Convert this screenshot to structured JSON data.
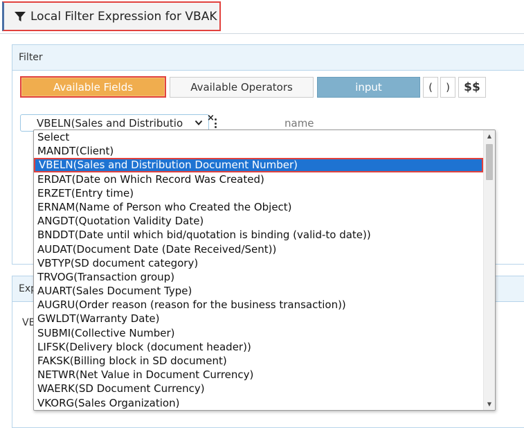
{
  "header": {
    "title": "Local Filter Expression for VBAK",
    "icon": "filter-icon"
  },
  "filter": {
    "section_label": "Filter",
    "buttons": {
      "available_fields": "Available Fields",
      "available_operators": "Available Operators",
      "input": "input",
      "open_paren": "(",
      "close_paren": ")",
      "dollars": "$$"
    },
    "field_select": {
      "value": "VBELN(Sales and Distributio"
    },
    "remove_symbol": "×",
    "name_placeholder": "name"
  },
  "expression": {
    "section_label": "Exp",
    "content": "VB"
  },
  "dropdown": {
    "options": [
      "Select",
      "MANDT(Client)",
      "VBELN(Sales and Distribution Document Number)",
      "ERDAT(Date on Which Record Was Created)",
      "ERZET(Entry time)",
      "ERNAM(Name of Person who Created the Object)",
      "ANGDT(Quotation Validity Date)",
      "BNDDT(Date until which bid/quotation is binding (valid-to date))",
      "AUDAT(Document Date (Date Received/Sent))",
      "VBTYP(SD document category)",
      "TRVOG(Transaction group)",
      "AUART(Sales Document Type)",
      "AUGRU(Order reason (reason for the business transaction))",
      "GWLDT(Warranty Date)",
      "SUBMI(Collective Number)",
      "LIFSK(Delivery block (document header))",
      "FAKSK(Billing block in SD document)",
      "NETWR(Net Value in Document Currency)",
      "WAERK(SD Document Currency)",
      "VKORG(Sales Organization)"
    ],
    "selected_index": 2
  },
  "colors": {
    "accent_orange": "#f0ad4e",
    "input_blue": "#7fb0cc",
    "selection_blue": "#1e73d2",
    "highlight_red": "#e1413d",
    "panel_header": "#eaf4fb"
  }
}
